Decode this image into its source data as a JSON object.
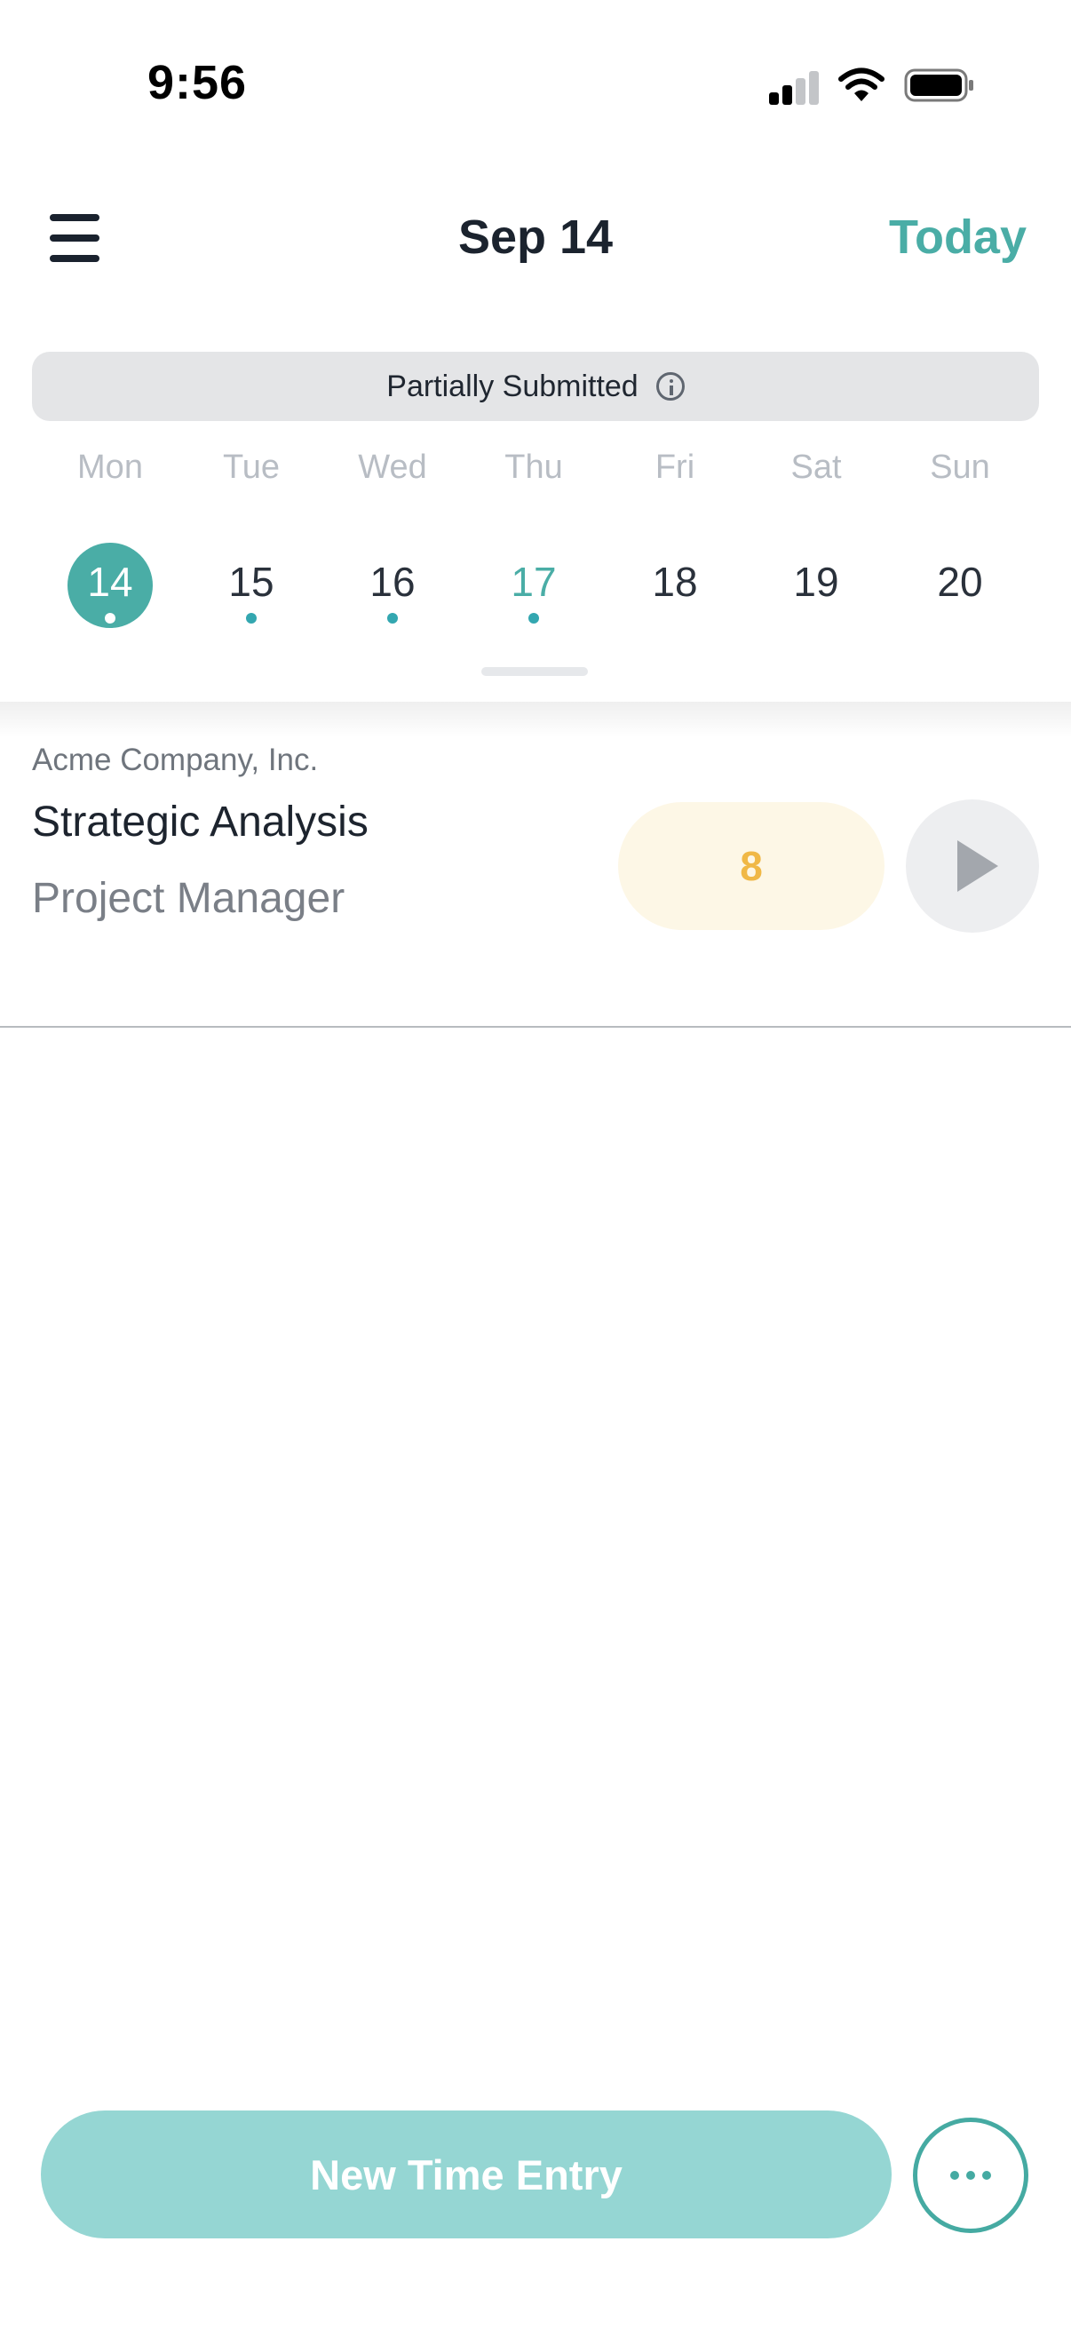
{
  "status_bar": {
    "time": "9:56",
    "icons": [
      "cellular-signal-icon",
      "wifi-icon",
      "battery-icon"
    ]
  },
  "header": {
    "menu_icon": "hamburger-menu-icon",
    "title": "Sep 14",
    "today_label": "Today"
  },
  "banner": {
    "text": "Partially Submitted",
    "icon": "info-icon"
  },
  "week": {
    "days": [
      {
        "dow": "Mon",
        "num": "14",
        "selected": true,
        "has_entries": true
      },
      {
        "dow": "Tue",
        "num": "15",
        "selected": false,
        "has_entries": true
      },
      {
        "dow": "Wed",
        "num": "16",
        "selected": false,
        "has_entries": true
      },
      {
        "dow": "Thu",
        "num": "17",
        "selected": false,
        "is_today": true,
        "has_entries": true
      },
      {
        "dow": "Fri",
        "num": "18",
        "selected": false,
        "has_entries": false
      },
      {
        "dow": "Sat",
        "num": "19",
        "selected": false,
        "has_entries": false
      },
      {
        "dow": "Sun",
        "num": "20",
        "selected": false,
        "has_entries": false
      }
    ]
  },
  "entries": [
    {
      "company": "Acme Company, Inc.",
      "title": "Strategic Analysis",
      "role": "Project Manager",
      "hours": "8",
      "action_icon": "play-icon"
    }
  ],
  "actions": {
    "new_entry_label": "New Time Entry",
    "more_icon": "more-options-icon"
  },
  "colors": {
    "accent": "#4aada6",
    "accent_light": "#95d6d3",
    "hours_text": "#f0b846",
    "hours_bg": "#fdf7e6",
    "banner_bg": "#e4e5e7"
  }
}
